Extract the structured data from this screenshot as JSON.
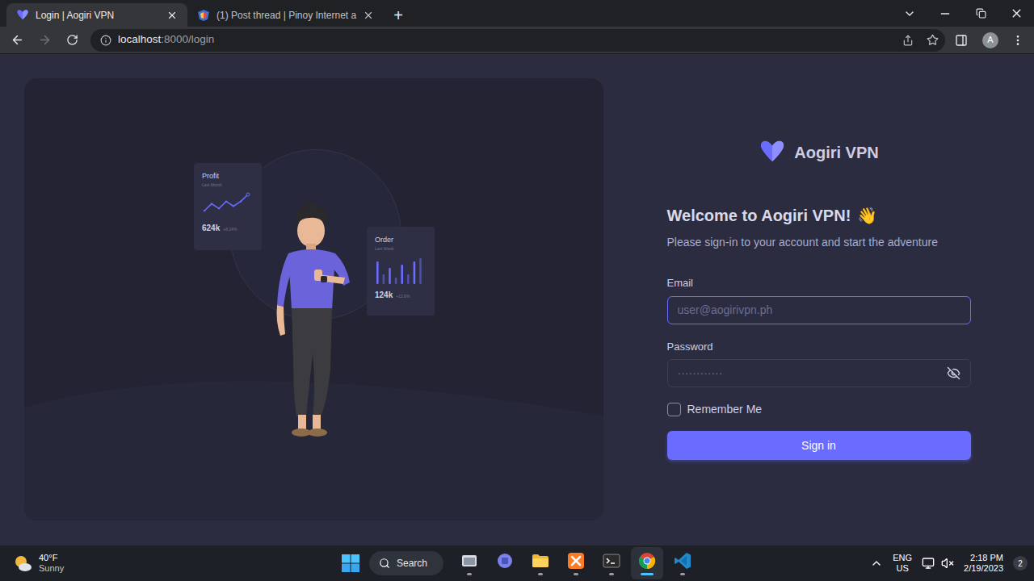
{
  "browser": {
    "tabs": [
      {
        "title": "Login | Aogiri VPN",
        "selected": true
      },
      {
        "title": "(1) Post thread | Pinoy Internet a",
        "selected": false
      }
    ],
    "new_tab": "+",
    "address": {
      "host": "localhost",
      "path": ":8000/login"
    },
    "profile": "A",
    "nav": {
      "back_enabled": true,
      "forward_enabled": false
    }
  },
  "illustration": {
    "profit_card": {
      "title": "Profit",
      "subtitle": "Last Month",
      "value": "624k",
      "change": "+8.24%",
      "series": [
        2,
        5,
        3,
        6,
        4,
        6,
        9
      ]
    },
    "order_card": {
      "title": "Order",
      "subtitle": "Last Week",
      "value": "124k",
      "change": "+12.6%",
      "series": [
        7,
        3,
        5,
        2,
        6,
        3,
        7,
        8
      ]
    }
  },
  "login": {
    "brand": "Aogiri VPN",
    "title": "Welcome to Aogiri VPN!",
    "emoji": "👋",
    "subtitle": "Please sign-in to your account and start the adventure",
    "fields": [
      {
        "label": "Email",
        "placeholder": "user@aogirivpn.ph",
        "focused": true,
        "kind": "text"
      },
      {
        "label": "Password",
        "placeholder": "············",
        "focused": false,
        "kind": "password"
      }
    ],
    "remember": {
      "label": "Remember Me",
      "checked": false
    },
    "submit": "Sign in"
  },
  "taskbar": {
    "weather": {
      "temp": "40°F",
      "condition": "Sunny"
    },
    "search": "Search",
    "apps": [
      {
        "kind": "explorer",
        "running": true,
        "active": false
      },
      {
        "kind": "teams",
        "running": false,
        "active": false
      },
      {
        "kind": "folder",
        "running": true,
        "active": false
      },
      {
        "kind": "xampp",
        "running": true,
        "active": false
      },
      {
        "kind": "terminal",
        "running": true,
        "active": false
      },
      {
        "kind": "chrome",
        "running": true,
        "active": true
      },
      {
        "kind": "vscode",
        "running": true,
        "active": false
      }
    ],
    "language": {
      "lang": "ENG",
      "region": "US"
    },
    "clock": {
      "time": "2:18 PM",
      "date": "2/19/2023"
    },
    "notifications": "2"
  }
}
